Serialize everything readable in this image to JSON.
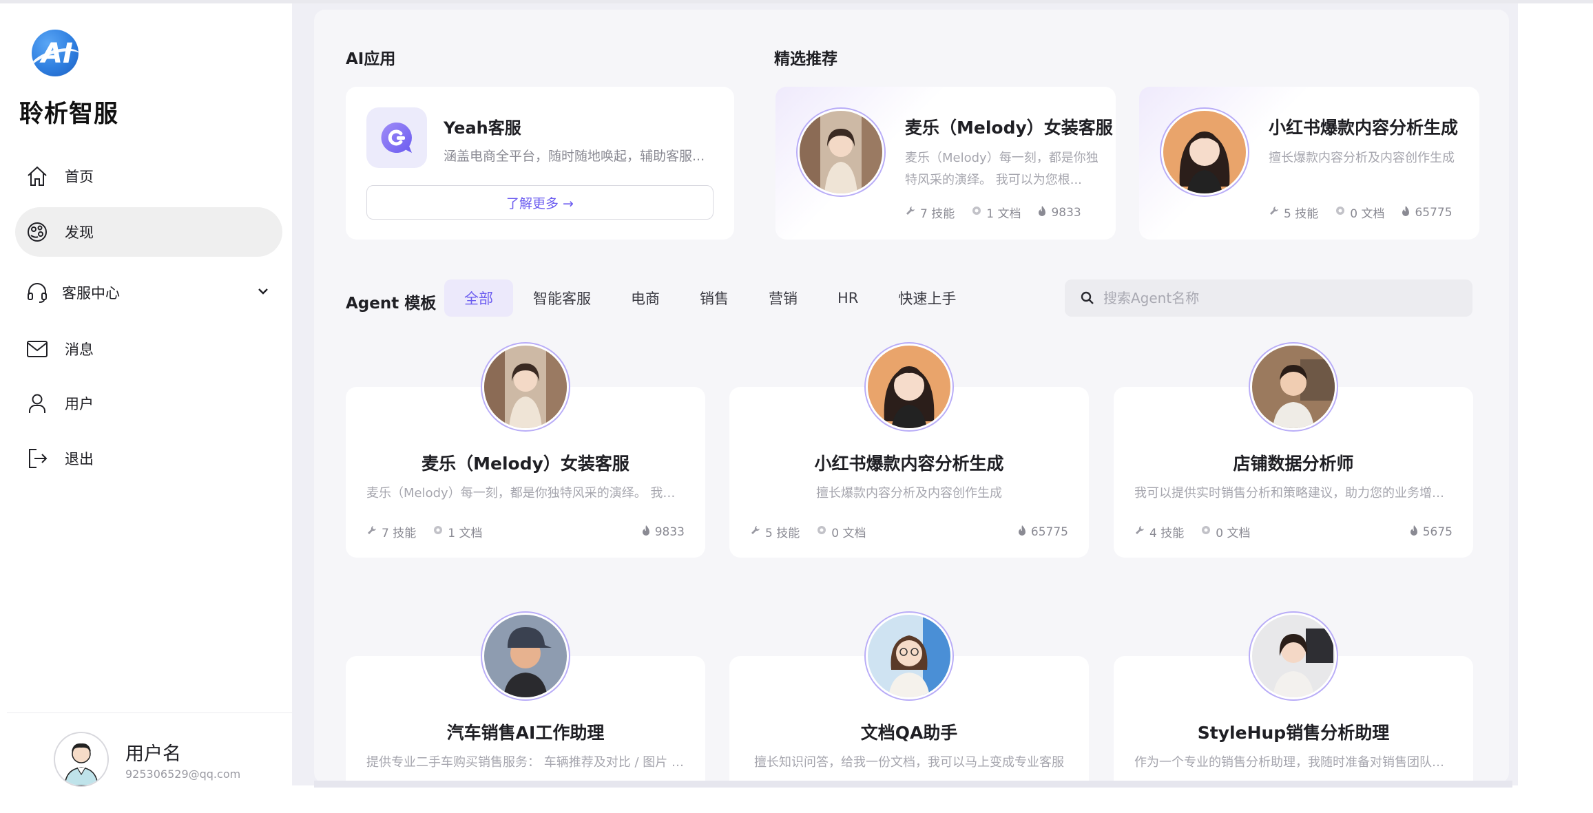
{
  "brand": {
    "name": "聆析智服",
    "logo_text": "AI"
  },
  "sidebar": {
    "items": [
      {
        "label": "首页",
        "icon": "home-icon"
      },
      {
        "label": "发现",
        "icon": "discover-icon",
        "active": true
      },
      {
        "label": "客服中心",
        "icon": "headset-icon",
        "expandable": true
      },
      {
        "label": "消息",
        "icon": "mail-icon"
      },
      {
        "label": "用户",
        "icon": "user-icon"
      },
      {
        "label": "退出",
        "icon": "logout-icon"
      }
    ],
    "user": {
      "name": "用户名",
      "email": "925306529@qq.com"
    }
  },
  "ai_apps": {
    "title": "AI应用",
    "card": {
      "name": "Yeah客服",
      "desc": "涵盖电商全平台，随时随地唤起，辅助客服...",
      "button": "了解更多 →"
    }
  },
  "featured": {
    "title": "精选推荐",
    "items": [
      {
        "name": "麦乐（Melody）女装客服",
        "desc": "麦乐（Melody）每一刻，都是你独特风采的演绎。 我可以为您根...",
        "skills": "7 技能",
        "docs": "1 文档",
        "hot": "9833"
      },
      {
        "name": "小红书爆款内容分析生成",
        "desc": "擅长爆款内容分析及内容创作生成",
        "skills": "5 技能",
        "docs": "0 文档",
        "hot": "65775"
      }
    ]
  },
  "agents": {
    "title": "Agent 模板",
    "tabs": [
      "全部",
      "智能客服",
      "电商",
      "销售",
      "营销",
      "HR",
      "快速上手"
    ],
    "active_tab": "全部",
    "search_placeholder": "搜索Agent名称",
    "items": [
      {
        "name": "麦乐（Melody）女装客服",
        "desc": "麦乐（Melody）每一刻，都是你独特风采的演绎。 我可...",
        "skills": "7 技能",
        "docs": "1 文档",
        "hot": "9833"
      },
      {
        "name": "小红书爆款内容分析生成",
        "desc": "擅长爆款内容分析及内容创作生成",
        "skills": "5 技能",
        "docs": "0 文档",
        "hot": "65775"
      },
      {
        "name": "店铺数据分析师",
        "desc": "我可以提供实时销售分析和策略建议，助力您的业务增长...",
        "skills": "4 技能",
        "docs": "0 文档",
        "hot": "5675"
      },
      {
        "name": "汽车销售AI工作助理",
        "desc": "提供专业二手车购买销售服务： 车辆推荐及对比 / 图片 / ..."
      },
      {
        "name": "文档QA助手",
        "desc": "擅长知识问答，给我一份文档，我可以马上变成专业客服"
      },
      {
        "name": "StyleHup销售分析助理",
        "desc": "作为一个专业的销售分析助理，我随时准备对销售团队的..."
      }
    ]
  },
  "colors": {
    "accent": "#6b5cf0",
    "active_tab_bg": "#ece9fb",
    "page_bg": "#f6f6f9"
  }
}
